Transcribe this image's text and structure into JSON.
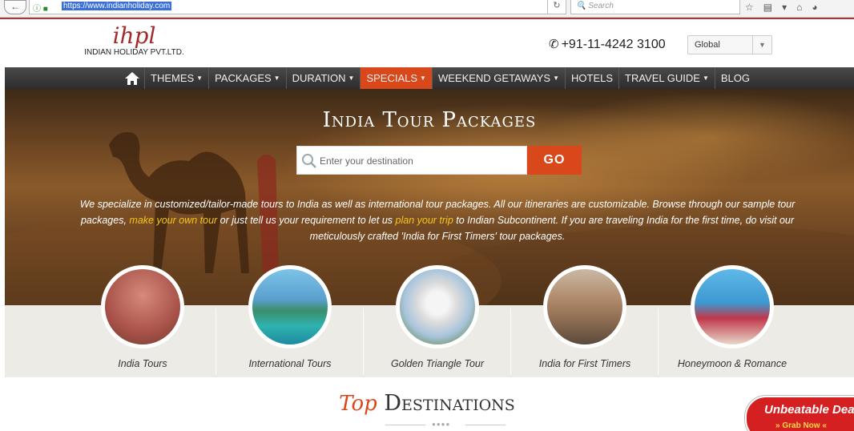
{
  "browser": {
    "url": "https://www.indianholiday.com",
    "search_placeholder": "Search"
  },
  "header": {
    "logo_mark": "ihpl",
    "logo_name": "INDIAN HOLIDAY PVT.LTD.",
    "phone": "+91-11-4242 3100",
    "region_selected": "Global"
  },
  "nav": {
    "items": [
      {
        "label": "THEMES",
        "dropdown": true,
        "active": false
      },
      {
        "label": "PACKAGES",
        "dropdown": true,
        "active": false
      },
      {
        "label": "DURATION",
        "dropdown": true,
        "active": false
      },
      {
        "label": "SPECIALS",
        "dropdown": true,
        "active": true
      },
      {
        "label": "WEEKEND GETAWAYS",
        "dropdown": true,
        "active": false
      },
      {
        "label": "HOTELS",
        "dropdown": false,
        "active": false
      },
      {
        "label": "TRAVEL GUIDE",
        "dropdown": true,
        "active": false
      },
      {
        "label": "BLOG",
        "dropdown": false,
        "active": false
      }
    ],
    "active_color": "#d9481b"
  },
  "hero": {
    "title": "India Tour Packages",
    "search_placeholder": "Enter your destination",
    "go_label": "GO",
    "text_part1": "We specialize in customized/tailor-made tours to India as well as international tour packages. All our itineraries are customizable. Browse through our sample tour packages, ",
    "link1": "make your own tour",
    "text_part2": " or just tell us your requirement to let us ",
    "link2": "plan your trip",
    "text_part3": " to Indian Subcontinent. If you are traveling India for the first time, do visit our meticulously crafted 'India for First Timers' tour packages."
  },
  "categories": [
    {
      "label": "India Tours",
      "icon": "hawa-mahal-image"
    },
    {
      "label": "International Tours",
      "icon": "island-boat-image"
    },
    {
      "label": "Golden Triangle Tour",
      "icon": "taj-mahal-image"
    },
    {
      "label": "India for First Timers",
      "icon": "traveler-city-image"
    },
    {
      "label": "Honeymoon & Romance",
      "icon": "couple-image"
    }
  ],
  "top_destinations": {
    "prefix": "Top",
    "title": "Destinations"
  },
  "deal_badge": {
    "line1": "Unbeatable Dea",
    "line2": "» Grab Now «"
  }
}
